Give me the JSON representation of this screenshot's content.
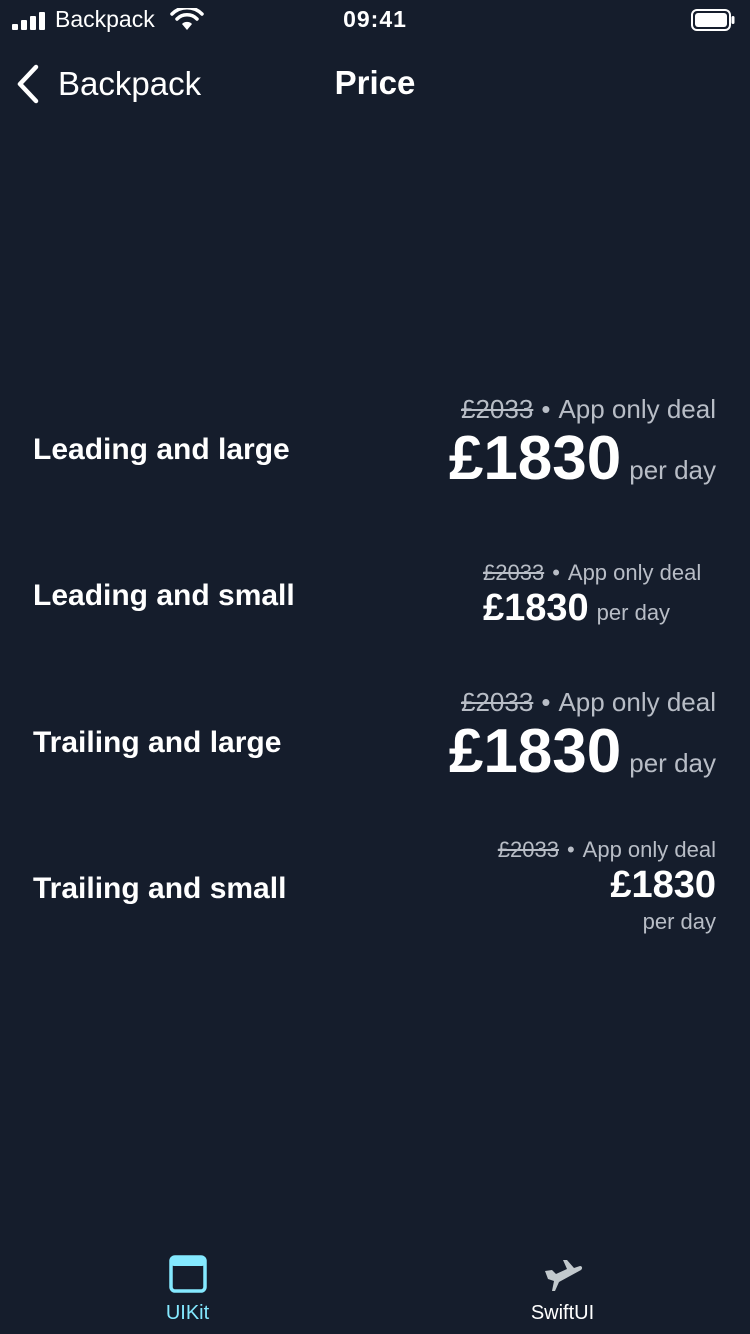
{
  "status_bar": {
    "carrier": "Backpack",
    "time": "09:41"
  },
  "nav": {
    "back_label": "Backpack",
    "title": "Price"
  },
  "rows": [
    {
      "label": "Leading and large",
      "old_price": "£2033",
      "deal": "App only deal",
      "price": "£1830",
      "unit": "per day"
    },
    {
      "label": "Leading and small",
      "old_price": "£2033",
      "deal": "App only deal",
      "price": "£1830",
      "unit": "per day"
    },
    {
      "label": "Trailing and large",
      "old_price": "£2033",
      "deal": "App only deal",
      "price": "£1830",
      "unit": "per day"
    },
    {
      "label": "Trailing and small",
      "old_price": "£2033",
      "deal": "App only deal",
      "price": "£1830",
      "unit": "per day"
    }
  ],
  "separator": "•",
  "tabs": [
    {
      "label": "UIKit",
      "selected": true
    },
    {
      "label": "SwiftUI",
      "selected": false
    }
  ],
  "colors": {
    "background": "#151d2c",
    "accent": "#84e9ff",
    "secondary_text": "#b8bdc6",
    "inactive_tab": "#c2c9cd"
  }
}
